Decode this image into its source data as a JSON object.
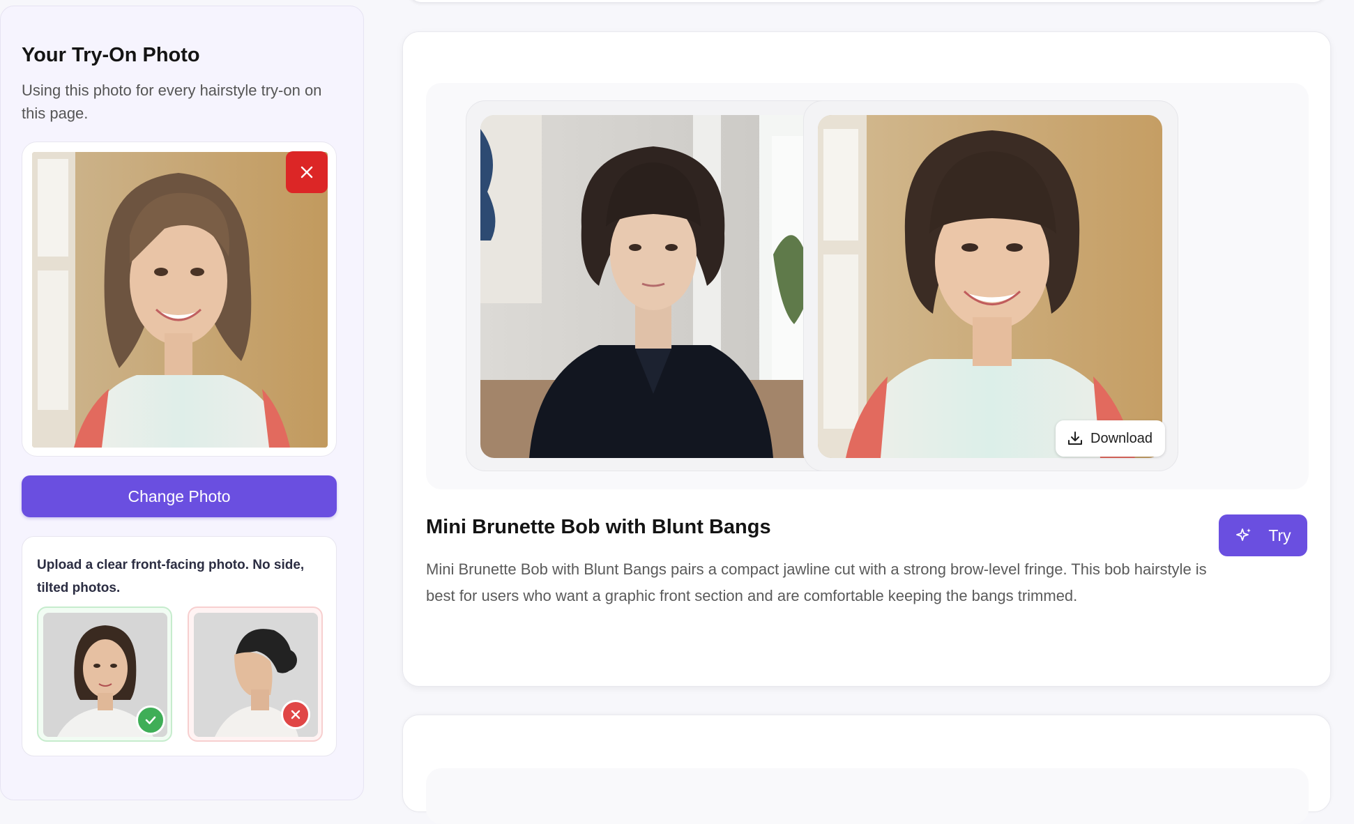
{
  "sidebar": {
    "title": "Your Try-On Photo",
    "subtitle": "Using this photo for every hairstyle try-on on this page.",
    "change_photo_label": "Change Photo",
    "tip_text": "Upload a clear front-facing photo. No side, tilted photos."
  },
  "style": {
    "title": "Mini Brunette Bob with Blunt Bangs",
    "description": "Mini Brunette Bob with Blunt Bangs pairs a compact jawline cut with a strong brow-level fringe. This bob hairstyle is best for users who want a graphic front section and are comfortable keeping the bangs trimmed.",
    "download_label": "Download",
    "try_label": "Try"
  },
  "colors": {
    "accent": "#6a4fe0",
    "danger": "#dc2626",
    "success": "#3fae57"
  }
}
